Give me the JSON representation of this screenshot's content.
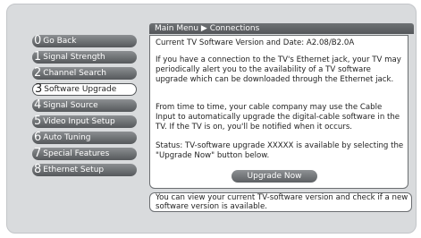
{
  "breadcrumb": "Main Menu ▶ Connections",
  "menu": [
    {
      "num": "0",
      "label": "Go Back",
      "selected": false
    },
    {
      "num": "1",
      "label": "Signal Strength",
      "selected": false
    },
    {
      "num": "2",
      "label": "Channel Search",
      "selected": false
    },
    {
      "num": "3",
      "label": "Software Upgrade",
      "selected": true
    },
    {
      "num": "4",
      "label": "Signal Source",
      "selected": false
    },
    {
      "num": "5",
      "label": "Video Input Setup",
      "selected": false
    },
    {
      "num": "6",
      "label": "Auto Tuning",
      "selected": false
    },
    {
      "num": "7",
      "label": "Special Features",
      "selected": false
    },
    {
      "num": "8",
      "label": "Ethernet Setup",
      "selected": false
    }
  ],
  "content": {
    "version_line": "Current TV Software Version and Date: A2.08/B2.0A",
    "para_ethernet": "If you have a connection to the TV's Ethernet jack, your TV may periodically alert you to the availability of a TV software upgrade which can be downloaded through the Ethernet jack.",
    "para_cable": "From time to time, your cable company may use the Cable Input to automatically upgrade the digital-cable software in the TV. If the TV is on, you'll be notified when it occurs.",
    "para_status": "Status: TV-software upgrade XXXXX is available by selecting the \"Upgrade Now\" button below.",
    "upgrade_button": "Upgrade Now"
  },
  "help_text": "You can view your current TV-software version and check if a new software version is available."
}
